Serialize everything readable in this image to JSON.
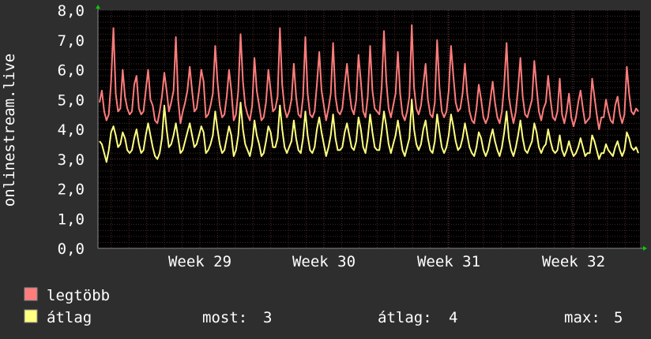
{
  "colors": {
    "background": "#2e2e2e",
    "plot_background": "#000000",
    "minor_grid": "#4a2a2a",
    "major_grid": "#5a3434",
    "axis": "#8a8a8a",
    "axis_arrow": "#00cc00",
    "max_series": "#ff7c7c",
    "avg_series": "#ffff80"
  },
  "chart_data": {
    "type": "line",
    "ylabel": "onlinestream.live",
    "ylim": [
      0,
      8
    ],
    "y_ticks": [
      "0,0",
      "1,0",
      "2,0",
      "3,0",
      "4,0",
      "5,0",
      "6,0",
      "7,0",
      "8,0"
    ],
    "x_ticks": [
      "Week 29",
      "Week 30",
      "Week 31",
      "Week 32"
    ],
    "grid": true,
    "legend_placement": "bottom-left",
    "series": [
      {
        "name": "legtöbb",
        "color": "#ff7c7c",
        "values": [
          4.9,
          5.3,
          4.6,
          4.3,
          4.5,
          5.6,
          7.4,
          5.2,
          4.6,
          4.7,
          6.0,
          5.1,
          4.7,
          4.5,
          4.6,
          5.5,
          5.8,
          4.7,
          4.5,
          4.6,
          5.3,
          6.0,
          5.0,
          4.8,
          4.3,
          4.2,
          4.6,
          5.1,
          5.9,
          5.3,
          4.6,
          4.9,
          5.3,
          7.1,
          5.0,
          4.2,
          4.6,
          4.9,
          5.3,
          6.1,
          5.3,
          4.6,
          4.7,
          5.3,
          6.0,
          5.6,
          4.4,
          4.5,
          4.8,
          5.2,
          6.8,
          5.6,
          4.8,
          4.4,
          4.5,
          5.1,
          6.0,
          5.3,
          4.3,
          4.5,
          5.3,
          7.2,
          5.6,
          4.8,
          4.5,
          4.3,
          4.8,
          6.4,
          5.3,
          4.8,
          4.3,
          4.4,
          4.9,
          6.0,
          5.3,
          4.6,
          4.7,
          5.1,
          7.4,
          5.5,
          4.7,
          4.4,
          4.6,
          5.0,
          6.2,
          5.1,
          4.5,
          4.4,
          5.1,
          7.1,
          5.2,
          4.5,
          4.4,
          4.6,
          5.5,
          6.6,
          5.3,
          4.8,
          4.3,
          4.7,
          5.2,
          6.9,
          5.1,
          4.6,
          4.5,
          4.7,
          5.5,
          6.2,
          5.3,
          4.7,
          4.5,
          5.0,
          6.5,
          5.6,
          4.6,
          4.4,
          5.1,
          6.8,
          5.3,
          4.7,
          4.6,
          4.5,
          5.4,
          7.3,
          5.6,
          4.7,
          4.4,
          4.8,
          5.2,
          6.6,
          5.2,
          4.5,
          4.3,
          4.6,
          5.1,
          7.5,
          5.4,
          4.7,
          4.5,
          4.8,
          5.5,
          6.2,
          5.0,
          4.5,
          4.4,
          4.9,
          7.0,
          5.4,
          4.6,
          4.4,
          4.6,
          5.3,
          6.8,
          5.8,
          4.9,
          4.6,
          4.7,
          5.2,
          6.2,
          5.2,
          4.6,
          4.3,
          4.2,
          4.7,
          5.5,
          5.0,
          4.4,
          4.2,
          4.4,
          5.0,
          5.6,
          4.9,
          4.4,
          4.2,
          4.6,
          5.5,
          6.9,
          5.1,
          4.6,
          4.2,
          4.6,
          5.4,
          6.4,
          5.1,
          4.5,
          4.4,
          4.7,
          5.0,
          6.3,
          5.4,
          4.6,
          4.3,
          4.7,
          4.9,
          5.8,
          5.0,
          4.4,
          4.3,
          4.6,
          5.7,
          4.5,
          4.2,
          4.6,
          5.2,
          4.4,
          4.1,
          4.4,
          4.9,
          5.3,
          4.7,
          4.2,
          4.3,
          4.4,
          5.7,
          5.1,
          4.5,
          4.0,
          4.4,
          4.4,
          5.0,
          4.6,
          4.3,
          4.2,
          4.8,
          5.1,
          4.5,
          4.2,
          4.5,
          6.1,
          5.2,
          4.6,
          4.5,
          4.7,
          4.6
        ]
      },
      {
        "name": "átlag",
        "color": "#ffff80",
        "values": [
          3.6,
          3.5,
          3.2,
          2.9,
          3.3,
          3.9,
          4.1,
          3.8,
          3.4,
          3.5,
          3.9,
          3.7,
          3.3,
          3.2,
          3.3,
          3.7,
          4.0,
          3.5,
          3.2,
          3.3,
          3.8,
          4.2,
          3.8,
          3.4,
          3.1,
          3.0,
          3.2,
          3.7,
          4.8,
          4.0,
          3.4,
          3.5,
          3.8,
          4.2,
          3.7,
          3.2,
          3.3,
          3.6,
          3.9,
          4.2,
          3.8,
          3.4,
          3.5,
          3.8,
          4.1,
          3.9,
          3.2,
          3.3,
          3.5,
          3.8,
          4.6,
          4.0,
          3.5,
          3.2,
          3.3,
          3.7,
          4.1,
          3.8,
          3.1,
          3.3,
          3.8,
          4.9,
          4.0,
          3.5,
          3.3,
          3.1,
          3.5,
          4.3,
          3.8,
          3.5,
          3.1,
          3.2,
          3.6,
          4.1,
          3.9,
          3.4,
          3.4,
          3.7,
          4.8,
          4.0,
          3.4,
          3.2,
          3.4,
          3.6,
          4.3,
          3.7,
          3.3,
          3.2,
          3.7,
          4.6,
          3.8,
          3.3,
          3.2,
          3.4,
          4.0,
          4.4,
          3.9,
          3.5,
          3.1,
          3.4,
          3.8,
          4.5,
          3.7,
          3.3,
          3.3,
          3.4,
          3.9,
          4.2,
          3.8,
          3.4,
          3.3,
          3.6,
          4.4,
          4.0,
          3.4,
          3.2,
          3.7,
          4.5,
          3.9,
          3.4,
          3.3,
          3.3,
          3.9,
          4.6,
          4.1,
          3.5,
          3.2,
          3.5,
          3.8,
          4.3,
          3.8,
          3.3,
          3.1,
          3.4,
          3.7,
          5.0,
          4.0,
          3.5,
          3.3,
          3.5,
          4.0,
          4.3,
          3.7,
          3.3,
          3.2,
          3.6,
          4.5,
          3.9,
          3.4,
          3.2,
          3.4,
          3.8,
          4.5,
          4.1,
          3.6,
          3.3,
          3.4,
          3.7,
          4.2,
          3.8,
          3.4,
          3.2,
          3.1,
          3.4,
          3.9,
          3.7,
          3.3,
          3.1,
          3.3,
          3.7,
          4.0,
          3.6,
          3.3,
          3.1,
          3.4,
          3.9,
          4.6,
          3.7,
          3.3,
          3.1,
          3.4,
          3.8,
          4.3,
          3.7,
          3.3,
          3.2,
          3.4,
          3.6,
          4.2,
          3.9,
          3.4,
          3.2,
          3.4,
          3.5,
          4.0,
          3.6,
          3.3,
          3.2,
          3.3,
          3.8,
          3.3,
          3.1,
          3.3,
          3.6,
          3.3,
          3.1,
          3.2,
          3.4,
          3.7,
          3.4,
          3.1,
          3.2,
          3.2,
          3.8,
          3.6,
          3.3,
          3.0,
          3.2,
          3.2,
          3.5,
          3.3,
          3.2,
          3.1,
          3.4,
          3.6,
          3.3,
          3.1,
          3.3,
          3.9,
          3.7,
          3.4,
          3.3,
          3.4,
          3.2
        ]
      }
    ],
    "stats": [
      {
        "label": "most:",
        "value": "3"
      },
      {
        "label": "átlag:",
        "value": "4"
      },
      {
        "label": "max:",
        "value": "5"
      }
    ]
  }
}
